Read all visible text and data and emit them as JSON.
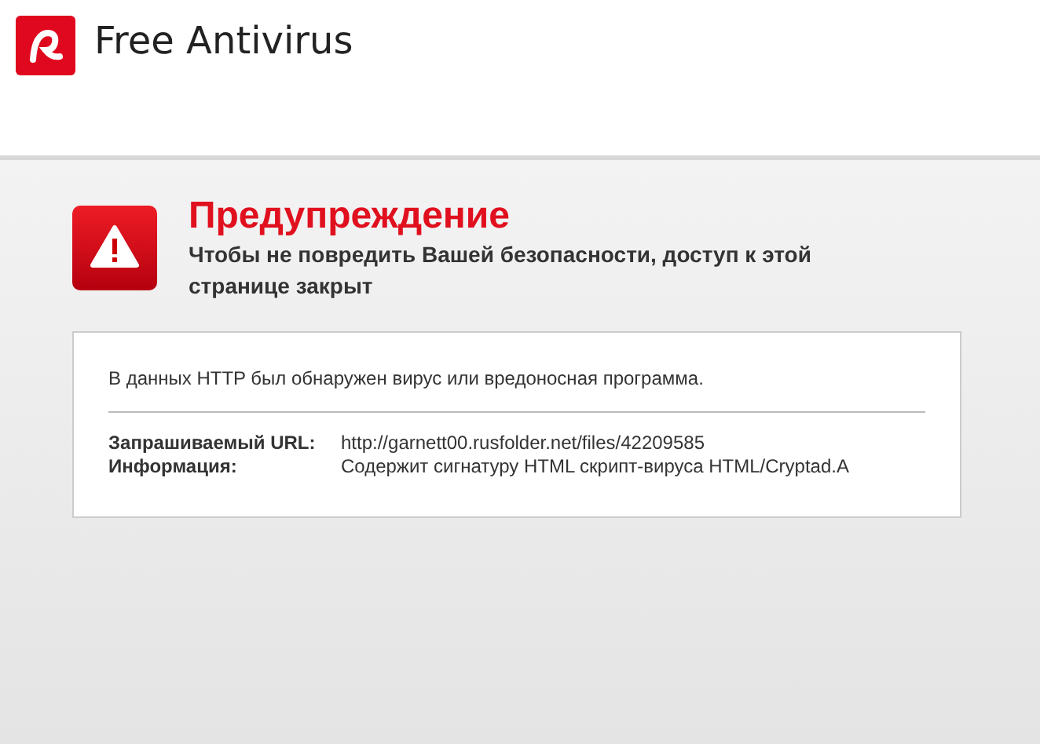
{
  "app": {
    "title": "Free Antivirus"
  },
  "warning": {
    "title": "Предупреждение",
    "subtitle": "Чтобы не повредить Вашей безопасности, доступ к этой странице закрыт"
  },
  "details": {
    "message": "В данных HTTP был обнаружен вирус или вредоносная программа.",
    "fields": [
      {
        "label": "Запрашиваемый URL:",
        "value": "http://garnett00.rusfolder.net/files/42209585"
      },
      {
        "label": "Информация:",
        "value": "Содержит сигнатуру HTML скрипт-вируса HTML/Cryptad.A"
      }
    ]
  }
}
